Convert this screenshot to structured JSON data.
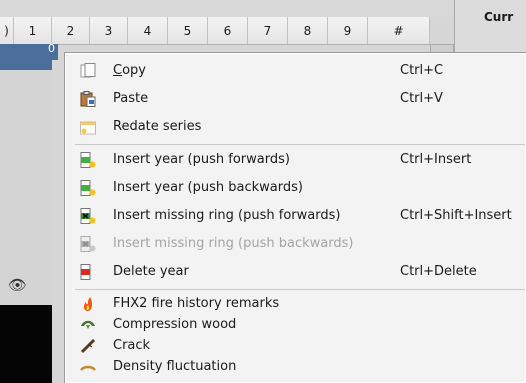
{
  "table": {
    "columns": [
      ")",
      "1",
      "2",
      "3",
      "4",
      "5",
      "6",
      "7",
      "8",
      "9",
      "#"
    ],
    "row_fragment": "0"
  },
  "side_panel": {
    "label": "Curr"
  },
  "menu": {
    "copy": {
      "mnemonic": "C",
      "rest": "opy",
      "shortcut": "Ctrl+C"
    },
    "paste": {
      "label": "Paste",
      "shortcut": "Ctrl+V"
    },
    "redate": {
      "label": "Redate series"
    },
    "insert_year_fwd": {
      "label": "Insert year (push forwards)",
      "shortcut": "Ctrl+Insert"
    },
    "insert_year_back": {
      "label": "Insert year (push backwards)"
    },
    "insert_missing_fwd": {
      "label": "Insert missing ring (push forwards)",
      "shortcut": "Ctrl+Shift+Insert"
    },
    "insert_missing_back": {
      "label": "Insert missing ring (push backwards)"
    },
    "delete_year": {
      "label": "Delete year",
      "shortcut": "Ctrl+Delete"
    },
    "fhx2": {
      "label": "FHX2 fire history remarks"
    },
    "compression": {
      "label": "Compression wood"
    },
    "crack": {
      "label": "Crack"
    },
    "density": {
      "label": "Density fluctuation"
    }
  }
}
